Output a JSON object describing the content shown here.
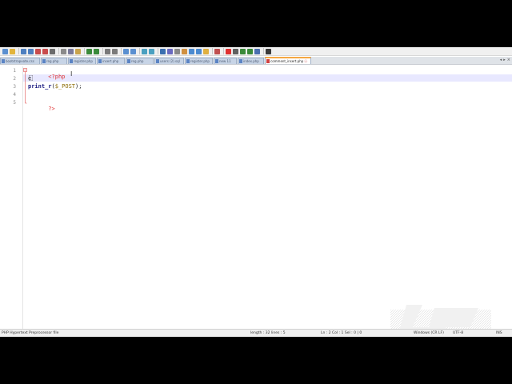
{
  "app": {
    "name": "Notepad++",
    "accent_color": "#f5a742"
  },
  "toolbar": {
    "icons": [
      "new-file-icon",
      "open-file-icon",
      "save-icon",
      "save-all-icon",
      "close-icon",
      "close-all-icon",
      "print-icon",
      "cut-icon",
      "copy-icon",
      "paste-icon",
      "undo-icon",
      "redo-icon",
      "find-icon",
      "replace-icon",
      "zoom-in-icon",
      "zoom-out-icon",
      "sync-vertical-icon",
      "sync-horizontal-icon",
      "word-wrap-icon",
      "show-all-chars-icon",
      "indent-guide-icon",
      "udl-icon",
      "doc-map-icon",
      "function-list-icon",
      "folder-workspace-icon",
      "monitoring-icon",
      "record-macro-icon",
      "stop-macro-icon",
      "play-macro-icon",
      "run-macro-icon",
      "save-macro-icon",
      "spell-check-icon"
    ]
  },
  "tabs": [
    {
      "label": "bootstrapvote.css"
    },
    {
      "label": "reg.php"
    },
    {
      "label": "register.php"
    },
    {
      "label": "insert.php"
    },
    {
      "label": "reg.php"
    },
    {
      "label": "users (2).sql"
    },
    {
      "label": "register.php"
    },
    {
      "label": "new 11"
    },
    {
      "label": "index.php"
    },
    {
      "label": "comment_insert.php",
      "active": true
    }
  ],
  "tab_nav": {
    "left": "◂",
    "right": "▸",
    "close": "×"
  },
  "editor": {
    "line_numbers": [
      "1",
      "2",
      "3",
      "4",
      "5"
    ],
    "lines": {
      "l1_open_tag": "<?php",
      "l2_text": "e",
      "l3_fn": "print_r",
      "l3_open": "(",
      "l3_var": "$_POST",
      "l3_close": ");",
      "l5_close_tag": "?>"
    }
  },
  "statusbar": {
    "file_type": "PHP Hypertext Preprocessor file",
    "length_lines": "length : 32    lines : 5",
    "position": "Ln : 2    Col : 1    Sel : 0 | 0",
    "eol": "Windows (CR LF)",
    "encoding": "UTF-8",
    "mode": "INS"
  }
}
